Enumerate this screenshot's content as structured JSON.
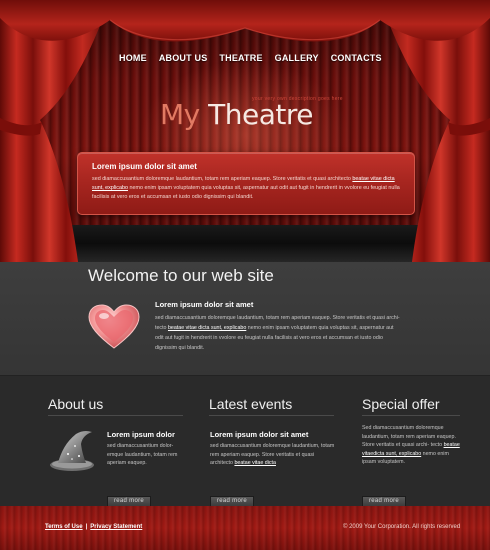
{
  "nav": {
    "items": [
      "HOME",
      "ABOUT US",
      "THEATRE",
      "GALLERY",
      "CONTACTS"
    ]
  },
  "header": {
    "tagline": "your very own description goes here",
    "title_my": "My",
    "title_theatre": "Theatre"
  },
  "intro": {
    "heading": "Lorem ipsum dolor sit amet",
    "text_before_link": "sed diamaccusantium doloremque laudantium, totam rem aperiam eaquep. Store veritatis et quasi architecto ",
    "link": "beatae vitae dicta sunt, explicabo",
    "text_after_link": " nemo enim ipsam voluptatem quia voluptas sit, aspernatur aut odit aut fugit in hendrerit in vvolore eu feugiat nulla facilisis at vero eros et accumsan et iusto odio dignissim qui blandit."
  },
  "welcome": {
    "heading": "Welcome to our web site",
    "subheading": "Lorem ipsum dolor sit amet",
    "text_before_link": "sed diamaccusantium doloremque laudantium, totam rem aperiam eaquep. Store veritatis et quasi archi- tecto ",
    "link": "beatae vitae dicta sunt, explicabo",
    "text_after_link": " nemo enim ipsam voluptatem quia voluptas sit, aspernatur aut odit aut fugit in hendrerit in vvolore eu feugiat nulla facilisis at vero eros et accumsan et iusto odio dignissim qui blandit."
  },
  "about": {
    "heading": "About us",
    "subheading": "Lorem ipsum dolor",
    "text": "sed diamaccusantium dolor- emque laudantium, totam rem aperiam eaquep.",
    "read_more": "read more"
  },
  "events": {
    "heading": "Latest events",
    "subheading": "Lorem ipsum dolor sit amet",
    "text_before_link": "sed diamaccusantium doloremque laudantium, totam rem aperiam eaquep. Store veritatis et quasi architecto ",
    "link": "beatae vitae dicta",
    "read_more": "read more"
  },
  "offer": {
    "heading": "Special offer",
    "text_before_link": "Sed diamaccusantium doloremque laudantium, totam rem aperiam eaquep. Store veritatis et quasi archi- tecto ",
    "link": "beatae vitaedicta sunt, explicabo",
    "text_after_link": " nemo enim ipsam voluptatem.",
    "read_more": "read more"
  },
  "footer": {
    "terms": "Terms of Use",
    "separator": "|",
    "privacy": "Privacy Statement",
    "copyright": "© 2009 Your Corporation.  All rights reserved"
  },
  "colors": {
    "curtain_red": "#a51c16",
    "title_accent": "#e27a63",
    "dark_bg": "#2b2b2b"
  },
  "icons": {
    "welcome": "heart-icon",
    "about": "wizard-hat-icon"
  }
}
